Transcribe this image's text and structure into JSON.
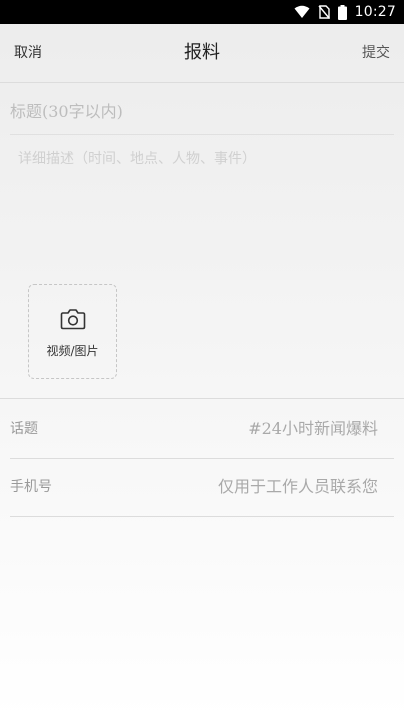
{
  "status_bar": {
    "time": "10:27",
    "icons": [
      "wifi-icon",
      "no-sim-icon",
      "battery-icon"
    ]
  },
  "nav": {
    "cancel_label": "取消",
    "title": "报料",
    "submit_label": "提交"
  },
  "form": {
    "title_placeholder": "标题(30字以内)",
    "title_value": "",
    "description_placeholder": "详细描述（时间、地点、人物、事件）",
    "description_value": "",
    "upload": {
      "icon": "camera-icon",
      "label": "视频/图片"
    },
    "topic": {
      "label": "话题",
      "value": "#24小时新闻爆料"
    },
    "phone": {
      "label": "手机号",
      "placeholder": "仅用于工作人员联系您"
    }
  },
  "colors": {
    "status_bar_bg": "#000000",
    "text_primary": "#222222",
    "placeholder": "#bdbdbd",
    "divider": "#dcdcdc"
  }
}
